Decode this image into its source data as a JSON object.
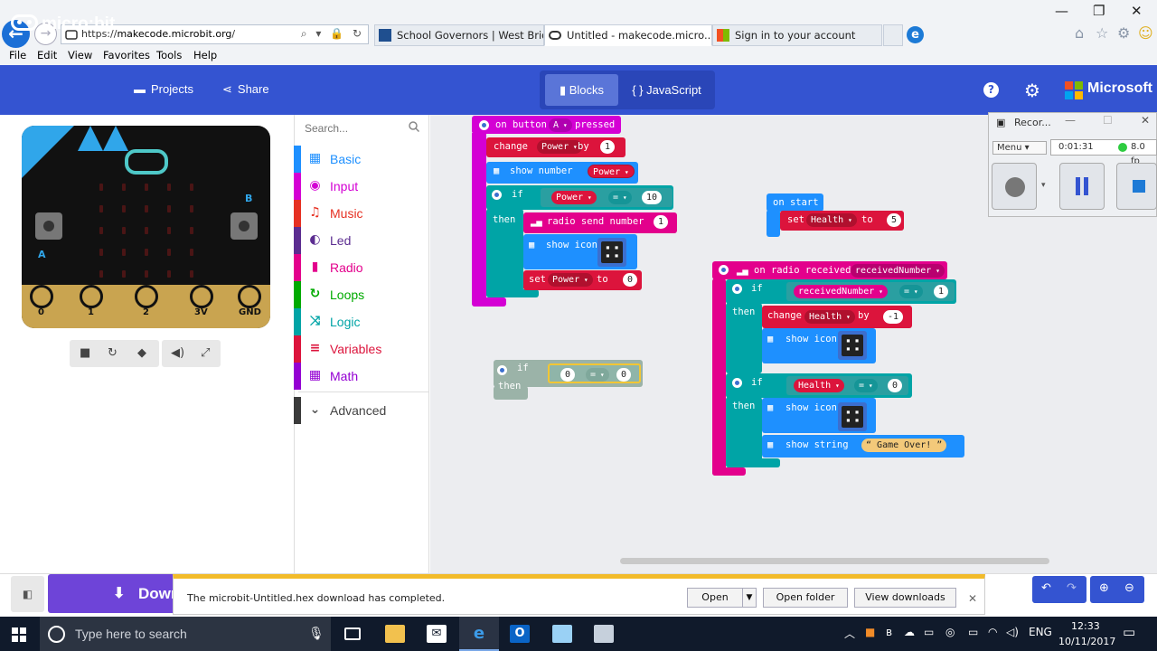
{
  "browser": {
    "url_prefix": "https://",
    "url_domain": "makecode.microbit.org",
    "url_path": "/",
    "tabs": [
      {
        "label": "School Governors | West Bridgf...",
        "favicon": "wb-icon"
      },
      {
        "label": "Untitled - makecode.micro...",
        "favicon": "microbit-icon",
        "close": "×"
      },
      {
        "label": "Sign in to your account",
        "favicon": "microsoft-icon"
      }
    ],
    "menu": [
      "File",
      "Edit",
      "View",
      "Favorites",
      "Tools",
      "Help"
    ],
    "window_controls": [
      "—",
      "❐",
      "✕"
    ]
  },
  "header": {
    "logo": "micro:bit",
    "projects_label": "Projects",
    "share_label": "Share",
    "blocks_label": "Blocks",
    "js_label": "{ } JavaScript",
    "brand": "Microsoft"
  },
  "simulator": {
    "button_a": "A",
    "button_b": "B",
    "pins": [
      "0",
      "1",
      "2",
      "3V",
      "GND"
    ]
  },
  "toolbox": {
    "search_placeholder": "Search...",
    "categories": [
      {
        "label": "Basic",
        "color": "#1e90ff",
        "icon": "▦"
      },
      {
        "label": "Input",
        "color": "#d400d4",
        "icon": "◉"
      },
      {
        "label": "Music",
        "color": "#e63022",
        "icon": "♫"
      },
      {
        "label": "Led",
        "color": "#5c2d91",
        "icon": "◐"
      },
      {
        "label": "Radio",
        "color": "#e3008c",
        "icon": "▮"
      },
      {
        "label": "Loops",
        "color": "#00aa00",
        "icon": "↻"
      },
      {
        "label": "Logic",
        "color": "#00a4a6",
        "icon": "⤨"
      },
      {
        "label": "Variables",
        "color": "#dc143c",
        "icon": "≡"
      },
      {
        "label": "Math",
        "color": "#9400d3",
        "icon": "▦"
      }
    ],
    "advanced_label": "Advanced"
  },
  "blocks": {
    "on_button": {
      "prefix": "on button",
      "button": "A",
      "suffix": "pressed"
    },
    "change_power": {
      "verb": "change",
      "var": "Power",
      "by": "by",
      "value": "1"
    },
    "show_number": {
      "label": "show number",
      "var": "Power"
    },
    "if1": {
      "if": "if",
      "then": "then",
      "var": "Power",
      "op": "=",
      "value": "10"
    },
    "radio_send": {
      "label": "radio send number",
      "value": "1"
    },
    "show_icon_1": {
      "label": "show icon"
    },
    "set_power": {
      "verb": "set",
      "var": "Power",
      "to": "to",
      "value": "0"
    },
    "on_start": {
      "label": "on start"
    },
    "set_health": {
      "verb": "set",
      "var": "Health",
      "to": "to",
      "value": "5"
    },
    "on_radio": {
      "label": "on radio received",
      "var": "receivedNumber"
    },
    "if2": {
      "if": "if",
      "then": "then",
      "var": "receivedNumber",
      "op": "=",
      "value": "1"
    },
    "change_health": {
      "verb": "change",
      "var": "Health",
      "by": "by",
      "value": "-1"
    },
    "show_icon_2": {
      "label": "show icon"
    },
    "if3": {
      "if": "if",
      "then": "then",
      "var": "Health",
      "op": "=",
      "value": "0"
    },
    "show_icon_3": {
      "label": "show icon"
    },
    "show_string": {
      "label": "show string",
      "value": "Game Over!"
    },
    "floating_if": {
      "if": "if",
      "then": "then",
      "left": "0",
      "op": "=",
      "right": "0"
    }
  },
  "recorder": {
    "title": "Recor...",
    "menu": "Menu",
    "time": "0:01:31",
    "fps": "8.0 fp"
  },
  "bottom": {
    "download_label": "Down",
    "notification": "The microbit-Untitled.hex download has completed.",
    "open_label": "Open",
    "open_folder_label": "Open folder",
    "view_downloads_label": "View downloads",
    "close": "✕"
  },
  "taskbar": {
    "search_placeholder": "Type here to search",
    "language": "ENG",
    "time": "12:33",
    "date": "10/11/2017"
  }
}
